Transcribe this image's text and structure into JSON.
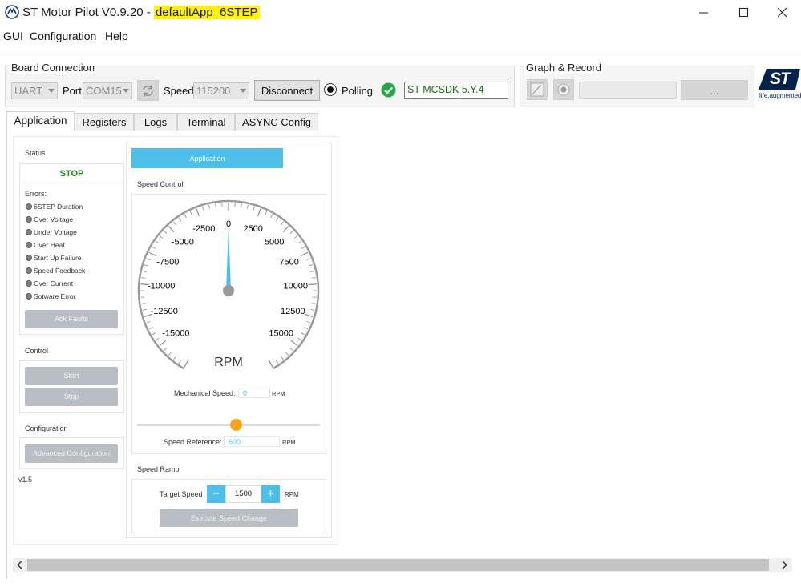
{
  "window": {
    "title_prefix": "ST Motor Pilot V0.9.20 - ",
    "title_highlight": "defaultApp_6STEP"
  },
  "menu": [
    "GUI",
    "Configuration",
    "Help"
  ],
  "board_connection": {
    "title": "Board Connection",
    "protocol": "UART",
    "port_label": "Port",
    "port": "COM15",
    "speed_label": "Speed",
    "speed": "115200",
    "disconnect_label": "Disconnect",
    "polling_label": "Polling",
    "firmware": "ST MCSDK 5.Y.4"
  },
  "graph_record": {
    "title": "Graph & Record",
    "browse_label": "..."
  },
  "logo": {
    "text": "ST",
    "tagline": "life.augmented"
  },
  "tabs": [
    "Application",
    "Registers",
    "Logs",
    "Terminal",
    "ASYNC Config"
  ],
  "status": {
    "title": "Status",
    "state": "STOP",
    "errors_label": "Errors:",
    "errors": [
      "6STEP Duration",
      "Over Voltage",
      "Under Voltage",
      "Over Heat",
      "Start Up Failure",
      "Speed Feedback",
      "Over Current",
      "Sotware Error"
    ],
    "ack_label": "Ack Faults"
  },
  "control": {
    "title": "Control",
    "start_label": "Start",
    "stop_label": "Stop"
  },
  "configuration": {
    "title": "Configuration",
    "advanced_label": "Advanced Configuration"
  },
  "version": "v1.5",
  "application": {
    "header": "Application",
    "speed_control_title": "Speed Control",
    "gauge": {
      "unit": "RPM",
      "min": -17500,
      "max": 17500,
      "value": 0,
      "labels": [
        "-15000",
        "-12500",
        "-10000",
        "-7500",
        "-5000",
        "-2500",
        "0",
        "2500",
        "5000",
        "7500",
        "10000",
        "12500",
        "15000"
      ]
    },
    "mech_speed_label": "Mechanical Speed:",
    "mech_speed_value": "0",
    "mech_speed_unit": "RPM",
    "speed_ref_label": "Speed Reference:",
    "speed_ref_value": "600",
    "speed_ref_unit": "RPM",
    "slider_fraction": 0.54,
    "speed_ramp_title": "Speed Ramp",
    "target_label": "Target Speed",
    "target_value": "1500",
    "target_unit": "RPM",
    "minus": "−",
    "plus": "+",
    "execute_label": "Execute Speed Change"
  },
  "colors": {
    "accent": "#4ebfe8",
    "stop_green": "#1a8a1a",
    "check_green": "#22a846",
    "orange_knob": "#f7a41c",
    "highlight": "#fff200"
  }
}
